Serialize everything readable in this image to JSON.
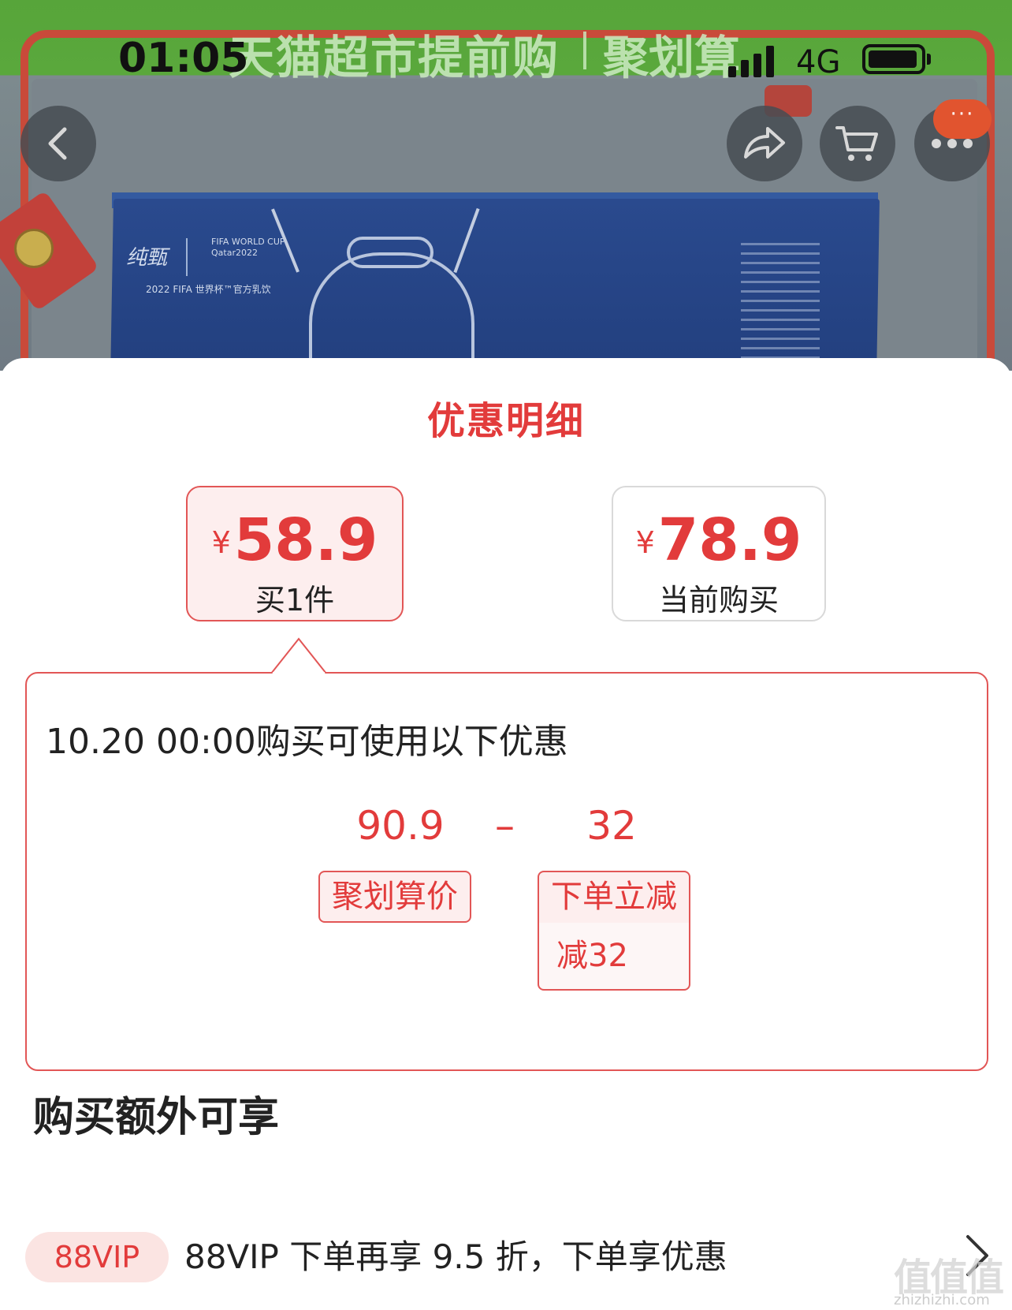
{
  "status_bar": {
    "time": "01:05",
    "network": "4G",
    "battery_level": 0.95
  },
  "banner": {
    "left_text": "天猫超市提前购",
    "right_text": "聚划算"
  },
  "product_box": {
    "brand": "纯甄",
    "fifa_line1": "FIFA WORLD CUP",
    "fifa_line2": "Qatar2022",
    "subline": "2022 FIFA 世界杯™官方乳饮"
  },
  "nav": {
    "back_icon": "chevron-left-icon",
    "share_icon": "share-icon",
    "cart_icon": "cart-icon",
    "more_icon": "more-dots-icon",
    "badge_text": "···"
  },
  "sheet": {
    "title": "优惠明细",
    "options": [
      {
        "currency": "¥",
        "price": "58.9",
        "label": "买1件",
        "selected": true
      },
      {
        "currency": "¥",
        "price": "78.9",
        "label": "当前购买",
        "selected": false
      }
    ],
    "detail": {
      "heading": "10.20 00:00购买可使用以下优惠",
      "base_price": "90.9",
      "operator": "–",
      "discount_value": "32",
      "base_tag": "聚划算价",
      "discount_tag": "下单立减",
      "discount_sub": "减32"
    },
    "extra": {
      "title": "购买额外可享",
      "vip_badge": "88VIP",
      "vip_text": "88VIP 下单再享 9.5 折，下单享优惠"
    }
  },
  "watermark": {
    "text": "值值值",
    "url": "zhizhizhi.com"
  },
  "colors": {
    "accent": "#e23b3b",
    "tag_bg": "#fdeeee",
    "vip_bg": "#fbe4e2"
  }
}
